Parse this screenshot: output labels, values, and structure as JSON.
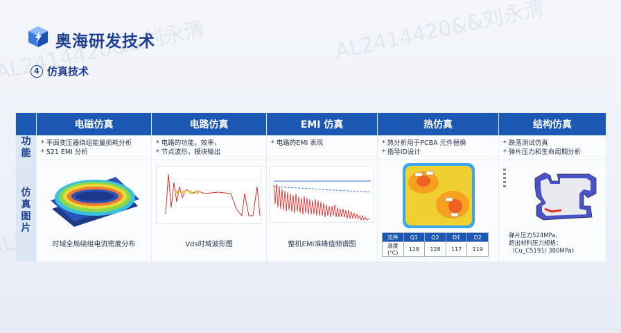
{
  "watermarks": [
    "AL2414420&&刘永清",
    "AL2414420&&刘永清",
    "AL2414420&&刘永清",
    "AL2414420&&刘永清"
  ],
  "header": {
    "brand": "奥海研发技术"
  },
  "section": {
    "number": "④",
    "title": "仿真技术"
  },
  "table": {
    "row_heads": {
      "function": "功\n能",
      "images": "仿\n真\n图\n片"
    },
    "columns": [
      {
        "title": "电磁仿真",
        "functions": [
          "* 平面变压器绕组能量损耗分析",
          "* S21 EMI 分析"
        ],
        "caption": "时域全局绕组电流密度分布"
      },
      {
        "title": "电路仿真",
        "functions": [
          "* 电路的功能，效率，",
          "* 节点波形，模块输出"
        ],
        "caption": "Vds时域波形图"
      },
      {
        "title": "EMI 仿真",
        "functions": [
          "* 电路的EMI 表现"
        ],
        "caption": "整机EMI准峰值频谱图"
      },
      {
        "title": "热仿真",
        "functions": [
          "* 热分析用于PCBA 元件替换",
          "* 指导ID设计"
        ],
        "caption": ""
      },
      {
        "title": "结构仿真",
        "functions": [
          "* 跌落测试仿真",
          "* 弹片压力和生命周期分析"
        ],
        "caption": ""
      }
    ],
    "thermal_table": {
      "headers": [
        "元件",
        "Q1",
        "Q2",
        "D1",
        "D2"
      ],
      "row": [
        "温度(℃)",
        "128",
        "128",
        "117",
        "119"
      ]
    },
    "structure_spec": [
      "弹片压力524MPa,",
      "超出材料压力规格：",
      "（Cu_C5191/ 380MPa)"
    ]
  },
  "colors": {
    "header_blue": "#1a58b3",
    "brand": "#1f3f8f"
  }
}
